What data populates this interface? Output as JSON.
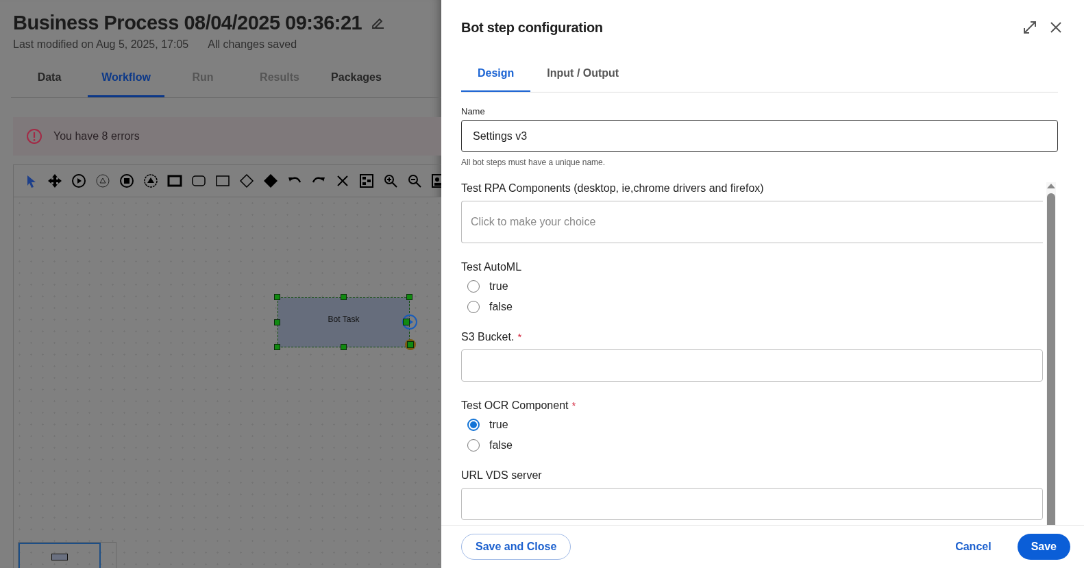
{
  "page": {
    "title": "Business Process 08/04/2025 09:36:21",
    "last_modified": "Last modified on Aug 5, 2025, 17:05",
    "save_status": "All changes saved"
  },
  "tabs": [
    {
      "label": "Data",
      "selected": false,
      "disabled": false
    },
    {
      "label": "Workflow",
      "selected": true,
      "disabled": false
    },
    {
      "label": "Run",
      "selected": false,
      "disabled": true
    },
    {
      "label": "Results",
      "selected": false,
      "disabled": true
    },
    {
      "label": "Packages",
      "selected": false,
      "disabled": false
    }
  ],
  "error_banner": {
    "text": "You have 8 errors"
  },
  "canvas": {
    "nodes": [
      {
        "label": "Bot Task",
        "selected": true
      }
    ]
  },
  "panel": {
    "title": "Bot step configuration",
    "tabs": [
      {
        "label": "Design",
        "selected": true
      },
      {
        "label": "Input / Output",
        "selected": false
      }
    ],
    "fields": [
      {
        "kind": "text",
        "label": "Name",
        "value": "Settings v3",
        "focused": true,
        "hint": "All bot steps must have a unique name."
      },
      {
        "kind": "select",
        "label": "Test RPA Components (desktop, ie,chrome drivers and firefox)",
        "placeholder": "Click to make your choice"
      },
      {
        "kind": "radio",
        "label": "Test AutoML",
        "options": [
          {
            "label": "true",
            "selected": false
          },
          {
            "label": "false",
            "selected": false
          }
        ]
      },
      {
        "kind": "text",
        "label": "S3 Bucket.",
        "required_mark": "*",
        "focused": false
      },
      {
        "kind": "radio",
        "label": "Test OCR Component",
        "required_mark": "*",
        "options": [
          {
            "label": "true",
            "selected": true
          },
          {
            "label": "false",
            "selected": false
          }
        ]
      },
      {
        "kind": "text",
        "label": "URL VDS server",
        "focused": false
      }
    ]
  },
  "footer": {
    "buttons": [
      {
        "label": "Save and Close",
        "kind": "outline"
      },
      {
        "label": "Cancel",
        "kind": "link"
      },
      {
        "label": "Save",
        "kind": "primary"
      }
    ]
  }
}
